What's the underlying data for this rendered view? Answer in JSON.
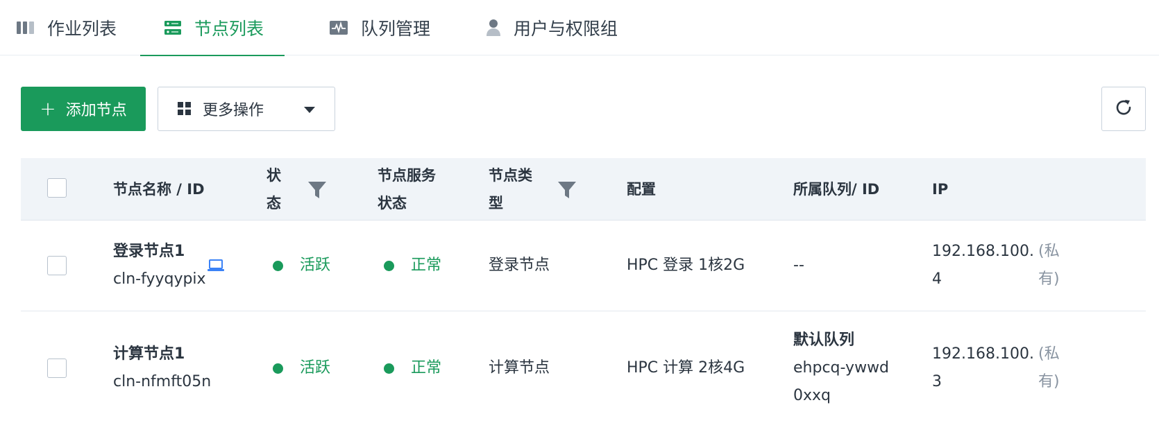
{
  "tabs": [
    {
      "label": "作业列表",
      "icon": "columns-icon",
      "active": false
    },
    {
      "label": "节点列表",
      "icon": "server-icon",
      "active": true
    },
    {
      "label": "队列管理",
      "icon": "monitor-pulse-icon",
      "active": false
    },
    {
      "label": "用户与权限组",
      "icon": "user-icon",
      "active": false
    }
  ],
  "toolbar": {
    "add_label": "添加节点",
    "more_label": "更多操作"
  },
  "table": {
    "headers": {
      "name": "节点名称 / ID",
      "status_line1": "状",
      "status_line2": "态",
      "service_line1": "节点服务",
      "service_line2": "状态",
      "type_line1": "节点类",
      "type_line2": "型",
      "config": "配置",
      "queue": "所属队列/ ID",
      "ip": "IP"
    },
    "rows": [
      {
        "name": "登录节点1",
        "id": "cln-fyyqypix",
        "status": "活跃",
        "service_status": "正常",
        "type": "登录节点",
        "config": "HPC 登录 1核2G",
        "queue_line1": "--",
        "ip_line1": "192.168.100.",
        "ip_line2": "4",
        "ip_tag_line1": "(私",
        "ip_tag_line2": "有)"
      },
      {
        "name": "计算节点1",
        "id": "cln-nfmft05n",
        "status": "活跃",
        "service_status": "正常",
        "type": "计算节点",
        "config": "HPC 计算 2核4G",
        "queue_line1": "默认队列",
        "queue_line2": "ehpcq-ywwd",
        "queue_line3": "0xxq",
        "ip_line1": "192.168.100.",
        "ip_line2": "3",
        "ip_tag_line1": "(私",
        "ip_tag_line2": "有)"
      }
    ]
  },
  "colors": {
    "accent": "#1a9a5b",
    "header_bg": "#f0f4f8",
    "text": "#2b3540",
    "muted": "#8893a0"
  }
}
